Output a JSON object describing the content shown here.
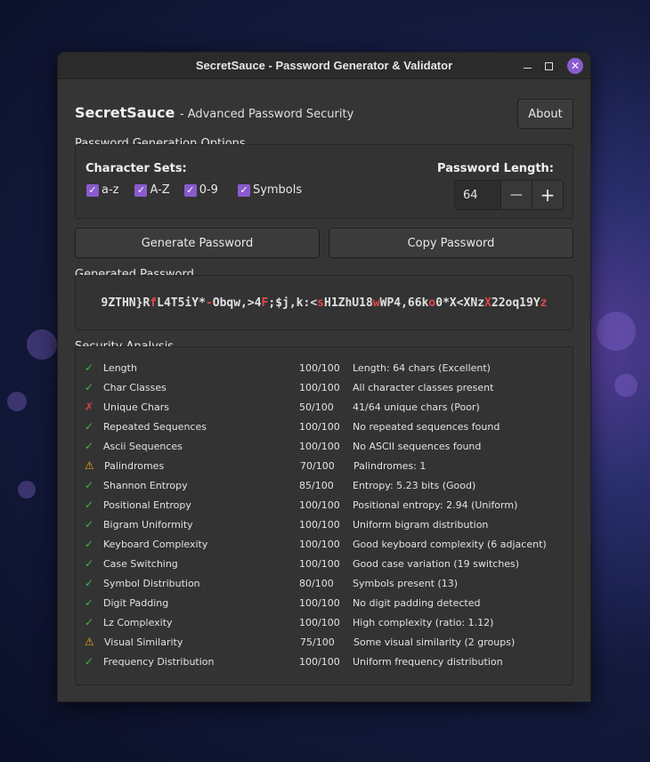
{
  "window": {
    "title": "SecretSauce - Password Generator & Validator",
    "close_glyph": "✕"
  },
  "header": {
    "app_name": "SecretSauce",
    "subtitle": "- Advanced Password Security",
    "about_label": "About"
  },
  "options": {
    "section_title": "Password Generation Options",
    "charsets_title": "Character Sets:",
    "charsets": [
      {
        "label": "a-z",
        "checked": true
      },
      {
        "label": "A-Z",
        "checked": true
      },
      {
        "label": "0-9",
        "checked": true
      },
      {
        "label": "Symbols",
        "checked": true
      }
    ],
    "length_title": "Password Length:",
    "length_value": "64",
    "minus_glyph": "—",
    "plus_glyph": "+"
  },
  "actions": {
    "generate_label": "Generate Password",
    "copy_label": "Copy Password"
  },
  "generated": {
    "section_title": "Generated Password",
    "password": "9ZTHN}RfL4T5iY*-Obqw,>4F;$j,k:<sH1ZhU18wWP4,66ko0*X<XNzX22oq19Yz",
    "segments": [
      {
        "t": "9ZTHN}R",
        "red": false
      },
      {
        "t": "f",
        "red": true
      },
      {
        "t": "L4T5iY*",
        "red": false
      },
      {
        "t": "-",
        "red": true
      },
      {
        "t": "Obqw,>4",
        "red": false
      },
      {
        "t": "F",
        "red": true
      },
      {
        "t": ";$j,k:<",
        "red": false
      },
      {
        "t": "s",
        "red": true
      },
      {
        "t": "H1ZhU18",
        "red": false
      },
      {
        "t": "w",
        "red": true
      },
      {
        "t": "WP4,66k",
        "red": false
      },
      {
        "t": "o",
        "red": true
      },
      {
        "t": "0*X<XNz",
        "red": false
      },
      {
        "t": "X",
        "red": true
      },
      {
        "t": "22oq19Y",
        "red": false
      },
      {
        "t": "z",
        "red": true
      }
    ]
  },
  "analysis": {
    "section_title": "Security Analysis",
    "icons": {
      "ok": "✓",
      "bad": "✗",
      "warn": "⚠"
    },
    "rows": [
      {
        "status": "ok",
        "name": "Length",
        "score": "100/100",
        "desc": "Length: 64 chars (Excellent)"
      },
      {
        "status": "ok",
        "name": "Char Classes",
        "score": "100/100",
        "desc": "All character classes present"
      },
      {
        "status": "bad",
        "name": "Unique Chars",
        "score": "50/100",
        "desc": "41/64 unique chars (Poor)"
      },
      {
        "status": "ok",
        "name": "Repeated Sequences",
        "score": "100/100",
        "desc": "No repeated sequences found"
      },
      {
        "status": "ok",
        "name": "Ascii Sequences",
        "score": "100/100",
        "desc": "No ASCII sequences found"
      },
      {
        "status": "warn",
        "name": "Palindromes",
        "score": "70/100",
        "desc": "Palindromes: 1"
      },
      {
        "status": "ok",
        "name": "Shannon Entropy",
        "score": "85/100",
        "desc": "Entropy: 5.23 bits (Good)"
      },
      {
        "status": "ok",
        "name": "Positional Entropy",
        "score": "100/100",
        "desc": "Positional entropy: 2.94 (Uniform)"
      },
      {
        "status": "ok",
        "name": "Bigram Uniformity",
        "score": "100/100",
        "desc": "Uniform bigram distribution"
      },
      {
        "status": "ok",
        "name": "Keyboard Complexity",
        "score": "100/100",
        "desc": "Good keyboard complexity (6 adjacent)"
      },
      {
        "status": "ok",
        "name": "Case Switching",
        "score": "100/100",
        "desc": "Good case variation (19 switches)"
      },
      {
        "status": "ok",
        "name": "Symbol Distribution",
        "score": "80/100",
        "desc": "Symbols present (13)"
      },
      {
        "status": "ok",
        "name": "Digit Padding",
        "score": "100/100",
        "desc": "No digit padding detected"
      },
      {
        "status": "ok",
        "name": "Lz Complexity",
        "score": "100/100",
        "desc": "High complexity (ratio: 1.12)"
      },
      {
        "status": "warn",
        "name": "Visual Similarity",
        "score": "75/100",
        "desc": "Some visual similarity (2 groups)"
      },
      {
        "status": "ok",
        "name": "Frequency Distribution",
        "score": "100/100",
        "desc": "Uniform frequency distribution"
      }
    ]
  },
  "colors": {
    "accent": "#8a5bd0",
    "ok": "#3bb54a",
    "bad": "#e04040",
    "warn": "#f0b000",
    "highlight": "#e0474c"
  }
}
